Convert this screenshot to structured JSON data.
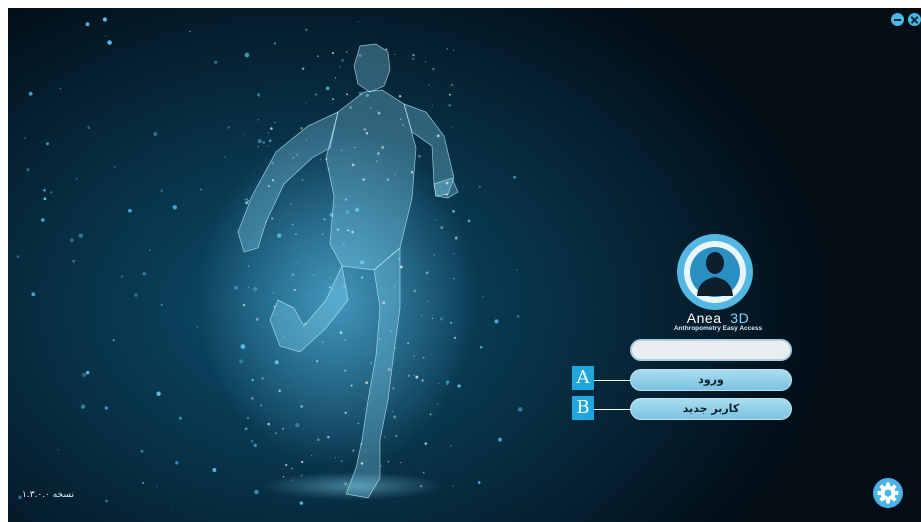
{
  "window": {
    "minimize_icon": "minimize-icon",
    "close_icon": "close-icon"
  },
  "brand": {
    "name": "Anea",
    "suffix": "3D",
    "tagline": "Anthropometry Easy Access",
    "logo_icon": "user-silhouette-icon"
  },
  "login": {
    "username_value": "",
    "login_label": "ورود",
    "new_user_label": "کاربر جدید"
  },
  "markers": {
    "a": "A",
    "b": "B"
  },
  "footer": {
    "version": "نسخه ۱.۳.۰.۰",
    "settings_icon": "gear-icon"
  },
  "colors": {
    "accent": "#4cb8e8",
    "button_fill": "#8fcde8",
    "marker": "#1fa6dd",
    "background_dark": "#041a28"
  }
}
